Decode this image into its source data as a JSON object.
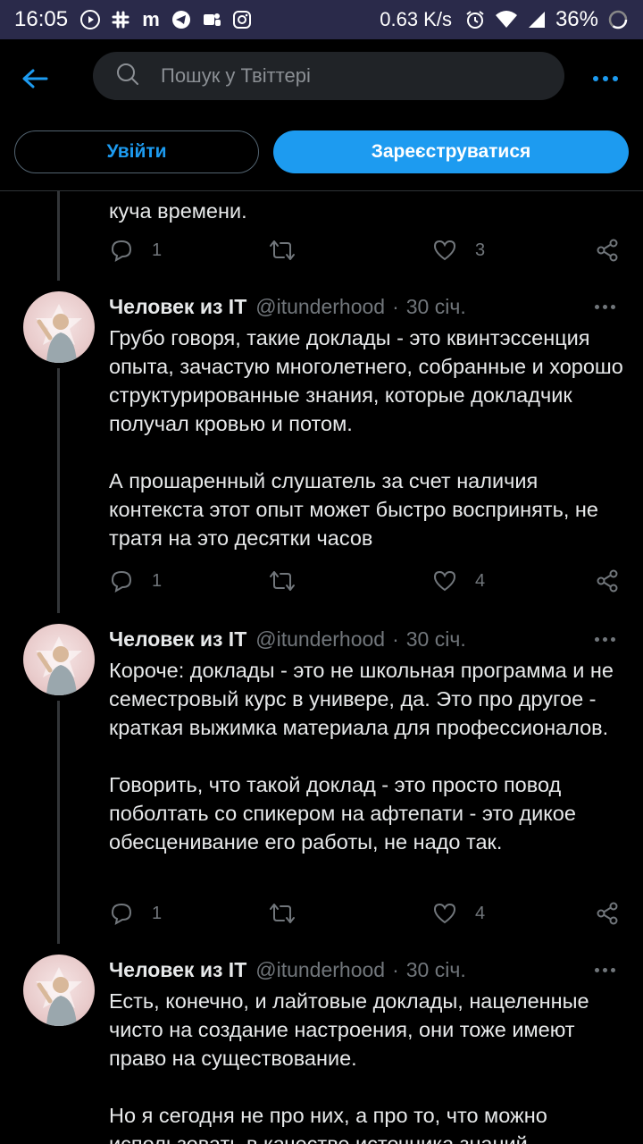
{
  "status_bar": {
    "time": "16:05",
    "speed": "0.63 K/s",
    "battery": "36%",
    "app_icons": [
      "youtube-icon",
      "slack-icon",
      "m-app-icon",
      "telegram-icon",
      "teams-icon",
      "instagram-icon"
    ]
  },
  "search": {
    "placeholder": "Пошук у Твіттері"
  },
  "auth": {
    "login_label": "Увійти",
    "signup_label": "Зареєструватися"
  },
  "colors": {
    "accent": "#1d9bf0",
    "background": "#000000",
    "muted": "#71767b",
    "text": "#e7e9ea"
  },
  "previous_tweet": {
    "text_tail": "куча времени.",
    "replies": "1",
    "retweets": "",
    "likes": "3"
  },
  "tweets": [
    {
      "name": "Человек из IT",
      "handle": "@itunderhood",
      "date": "30 січ.",
      "text": "Грубо говоря, такие доклады - это квинтэссенция опыта, зачастую многолетнего, собранные и хорошо структурированные знания, которые докладчик получал кровью и потом.\n\nА прошаренный слушатель за счет наличия контекста этот опыт может быстро воспринять, не тратя на это десятки часов",
      "replies": "1",
      "retweets": "",
      "likes": "4"
    },
    {
      "name": "Человек из IT",
      "handle": "@itunderhood",
      "date": "30 січ.",
      "text": "Короче: доклады - это не школьная программа и не семестровый курс в универе, да. Это про другое - краткая выжимка материала для профессионалов.\n\nГоворить, что такой доклад - это просто повод поболтать со спикером на афтепати - это дикое обесценивание его работы, не надо так.",
      "replies": "1",
      "retweets": "",
      "likes": "4"
    },
    {
      "name": "Человек из IT",
      "handle": "@itunderhood",
      "date": "30 січ.",
      "text": "Есть, конечно, и лайтовые доклады, нацеленные чисто на создание настроения, они тоже имеют право на существование.\n\nНо я сегодня не про них, а про то, что можно использовать в качестве источника знаний",
      "replies": "",
      "retweets": "",
      "likes": ""
    }
  ]
}
